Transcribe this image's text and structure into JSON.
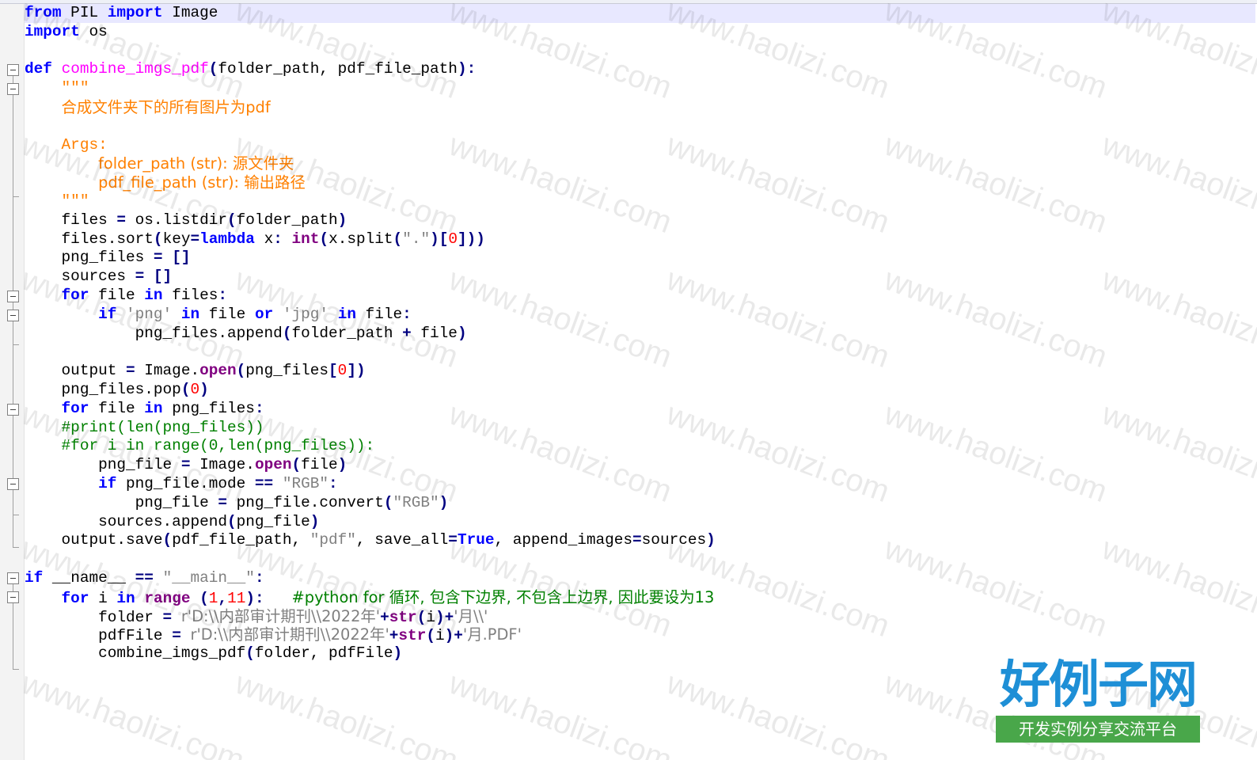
{
  "editor": {
    "lines": [
      {
        "hl": true,
        "tokens": [
          [
            "kw",
            "from"
          ],
          [
            "pl",
            " PIL "
          ],
          [
            "kw",
            "import"
          ],
          [
            "pl",
            " Image"
          ]
        ]
      },
      {
        "tokens": [
          [
            "kw",
            "import"
          ],
          [
            "pl",
            " os"
          ]
        ]
      },
      {
        "tokens": []
      },
      {
        "tokens": [
          [
            "kw",
            "def"
          ],
          [
            "pl",
            " "
          ],
          [
            "fn",
            "combine_imgs_pdf"
          ],
          [
            "op",
            "("
          ],
          [
            "pl",
            "folder_path, pdf_file_path"
          ],
          [
            "op",
            "):"
          ]
        ]
      },
      {
        "tokens": [
          [
            "pl",
            "    "
          ],
          [
            "doc",
            "\"\"\""
          ]
        ]
      },
      {
        "tokens": [
          [
            "pl",
            "    "
          ],
          [
            "doc",
            "合成文件夹下的所有图片为pdf"
          ]
        ]
      },
      {
        "tokens": []
      },
      {
        "tokens": [
          [
            "pl",
            "    "
          ],
          [
            "doc",
            "Args:"
          ]
        ]
      },
      {
        "tokens": [
          [
            "pl",
            "        "
          ],
          [
            "doc",
            "folder_path (str): 源文件夹"
          ]
        ]
      },
      {
        "tokens": [
          [
            "pl",
            "        "
          ],
          [
            "doc",
            "pdf_file_path (str): 输出路径"
          ]
        ]
      },
      {
        "tokens": [
          [
            "pl",
            "    "
          ],
          [
            "doc",
            "\"\"\""
          ]
        ]
      },
      {
        "tokens": [
          [
            "pl",
            "    files "
          ],
          [
            "op",
            "="
          ],
          [
            "pl",
            " os.listdir"
          ],
          [
            "op",
            "("
          ],
          [
            "pl",
            "folder_path"
          ],
          [
            "op",
            ")"
          ]
        ]
      },
      {
        "tokens": [
          [
            "pl",
            "    files.sort"
          ],
          [
            "op",
            "("
          ],
          [
            "pl",
            "key"
          ],
          [
            "op",
            "="
          ],
          [
            "kw",
            "lambda"
          ],
          [
            "pl",
            " x"
          ],
          [
            "op",
            ":"
          ],
          [
            "pl",
            " "
          ],
          [
            "bi",
            "int"
          ],
          [
            "op",
            "("
          ],
          [
            "pl",
            "x.split"
          ],
          [
            "op",
            "("
          ],
          [
            "str",
            "\".\""
          ],
          [
            "op",
            ")["
          ],
          [
            "num",
            "0"
          ],
          [
            "op",
            "]))"
          ]
        ]
      },
      {
        "tokens": [
          [
            "pl",
            "    png_files "
          ],
          [
            "op",
            "="
          ],
          [
            "pl",
            " "
          ],
          [
            "op",
            "[]"
          ]
        ]
      },
      {
        "tokens": [
          [
            "pl",
            "    sources "
          ],
          [
            "op",
            "="
          ],
          [
            "pl",
            " "
          ],
          [
            "op",
            "[]"
          ]
        ]
      },
      {
        "tokens": [
          [
            "pl",
            "    "
          ],
          [
            "kw",
            "for"
          ],
          [
            "pl",
            " file "
          ],
          [
            "kw",
            "in"
          ],
          [
            "pl",
            " files"
          ],
          [
            "op",
            ":"
          ]
        ]
      },
      {
        "tokens": [
          [
            "pl",
            "        "
          ],
          [
            "kw",
            "if"
          ],
          [
            "pl",
            " "
          ],
          [
            "str",
            "'png'"
          ],
          [
            "pl",
            " "
          ],
          [
            "kw",
            "in"
          ],
          [
            "pl",
            " file "
          ],
          [
            "kw",
            "or"
          ],
          [
            "pl",
            " "
          ],
          [
            "str",
            "'jpg'"
          ],
          [
            "pl",
            " "
          ],
          [
            "kw",
            "in"
          ],
          [
            "pl",
            " file"
          ],
          [
            "op",
            ":"
          ]
        ]
      },
      {
        "tokens": [
          [
            "pl",
            "            png_files.append"
          ],
          [
            "op",
            "("
          ],
          [
            "pl",
            "folder_path "
          ],
          [
            "op",
            "+"
          ],
          [
            "pl",
            " file"
          ],
          [
            "op",
            ")"
          ]
        ]
      },
      {
        "tokens": []
      },
      {
        "tokens": [
          [
            "pl",
            "    output "
          ],
          [
            "op",
            "="
          ],
          [
            "pl",
            " Image."
          ],
          [
            "bi",
            "open"
          ],
          [
            "op",
            "("
          ],
          [
            "pl",
            "png_files"
          ],
          [
            "op",
            "["
          ],
          [
            "num",
            "0"
          ],
          [
            "op",
            "])"
          ]
        ]
      },
      {
        "tokens": [
          [
            "pl",
            "    png_files.pop"
          ],
          [
            "op",
            "("
          ],
          [
            "num",
            "0"
          ],
          [
            "op",
            ")"
          ]
        ]
      },
      {
        "tokens": [
          [
            "pl",
            "    "
          ],
          [
            "kw",
            "for"
          ],
          [
            "pl",
            " file "
          ],
          [
            "kw",
            "in"
          ],
          [
            "pl",
            " png_files"
          ],
          [
            "op",
            ":"
          ]
        ]
      },
      {
        "tokens": [
          [
            "pl",
            "    "
          ],
          [
            "cmt",
            "#print(len(png_files))"
          ]
        ]
      },
      {
        "tokens": [
          [
            "pl",
            "    "
          ],
          [
            "cmt",
            "#for i in range(0,len(png_files)):"
          ]
        ]
      },
      {
        "tokens": [
          [
            "pl",
            "        png_file "
          ],
          [
            "op",
            "="
          ],
          [
            "pl",
            " Image."
          ],
          [
            "bi",
            "open"
          ],
          [
            "op",
            "("
          ],
          [
            "pl",
            "file"
          ],
          [
            "op",
            ")"
          ]
        ]
      },
      {
        "tokens": [
          [
            "pl",
            "        "
          ],
          [
            "kw",
            "if"
          ],
          [
            "pl",
            " png_file.mode "
          ],
          [
            "op",
            "=="
          ],
          [
            "pl",
            " "
          ],
          [
            "str",
            "\"RGB\""
          ],
          [
            "op",
            ":"
          ]
        ]
      },
      {
        "tokens": [
          [
            "pl",
            "            png_file "
          ],
          [
            "op",
            "="
          ],
          [
            "pl",
            " png_file.convert"
          ],
          [
            "op",
            "("
          ],
          [
            "str",
            "\"RGB\""
          ],
          [
            "op",
            ")"
          ]
        ]
      },
      {
        "tokens": [
          [
            "pl",
            "        sources.append"
          ],
          [
            "op",
            "("
          ],
          [
            "pl",
            "png_file"
          ],
          [
            "op",
            ")"
          ]
        ]
      },
      {
        "tokens": [
          [
            "pl",
            "    output.save"
          ],
          [
            "op",
            "("
          ],
          [
            "pl",
            "pdf_file_path, "
          ],
          [
            "str",
            "\"pdf\""
          ],
          [
            "pl",
            ", save_all"
          ],
          [
            "op",
            "="
          ],
          [
            "kw",
            "True"
          ],
          [
            "pl",
            ", append_images"
          ],
          [
            "op",
            "="
          ],
          [
            "pl",
            "sources"
          ],
          [
            "op",
            ")"
          ]
        ]
      },
      {
        "tokens": []
      },
      {
        "tokens": [
          [
            "kw",
            "if"
          ],
          [
            "pl",
            " __name__ "
          ],
          [
            "op",
            "=="
          ],
          [
            "pl",
            " "
          ],
          [
            "str",
            "\"__main__\""
          ],
          [
            "op",
            ":"
          ]
        ]
      },
      {
        "tokens": [
          [
            "pl",
            "    "
          ],
          [
            "kw",
            "for"
          ],
          [
            "pl",
            " i "
          ],
          [
            "kw",
            "in"
          ],
          [
            "pl",
            " "
          ],
          [
            "bi",
            "range"
          ],
          [
            "pl",
            " "
          ],
          [
            "op",
            "("
          ],
          [
            "num",
            "1"
          ],
          [
            "op",
            ","
          ],
          [
            "num",
            "11"
          ],
          [
            "op",
            "):"
          ],
          [
            "pl",
            "   "
          ],
          [
            "cmt",
            "#python for 循环, 包含下边界, 不包含上边界, 因此要设为13"
          ]
        ]
      },
      {
        "tokens": [
          [
            "pl",
            "        folder "
          ],
          [
            "op",
            "="
          ],
          [
            "pl",
            " "
          ],
          [
            "str",
            "r'D:\\\\内部审计期刊\\\\2022年'"
          ],
          [
            "op",
            "+"
          ],
          [
            "bi",
            "str"
          ],
          [
            "op",
            "("
          ],
          [
            "pl",
            "i"
          ],
          [
            "op",
            ")+"
          ],
          [
            "str",
            "'月\\\\'"
          ]
        ]
      },
      {
        "tokens": [
          [
            "pl",
            "        pdfFile "
          ],
          [
            "op",
            "="
          ],
          [
            "pl",
            " "
          ],
          [
            "str",
            "r'D:\\\\内部审计期刊\\\\2022年'"
          ],
          [
            "op",
            "+"
          ],
          [
            "bi",
            "str"
          ],
          [
            "op",
            "("
          ],
          [
            "pl",
            "i"
          ],
          [
            "op",
            ")+"
          ],
          [
            "str",
            "'月.PDF'"
          ]
        ]
      },
      {
        "tokens": [
          [
            "pl",
            "        combine_imgs_pdf"
          ],
          [
            "op",
            "("
          ],
          [
            "pl",
            "folder, pdfFile"
          ],
          [
            "op",
            ")"
          ]
        ]
      }
    ]
  },
  "watermark": {
    "text": "www.haolizi.com"
  },
  "logo": {
    "title": "好例子网",
    "subtitle": "开发实例分享交流平台"
  }
}
